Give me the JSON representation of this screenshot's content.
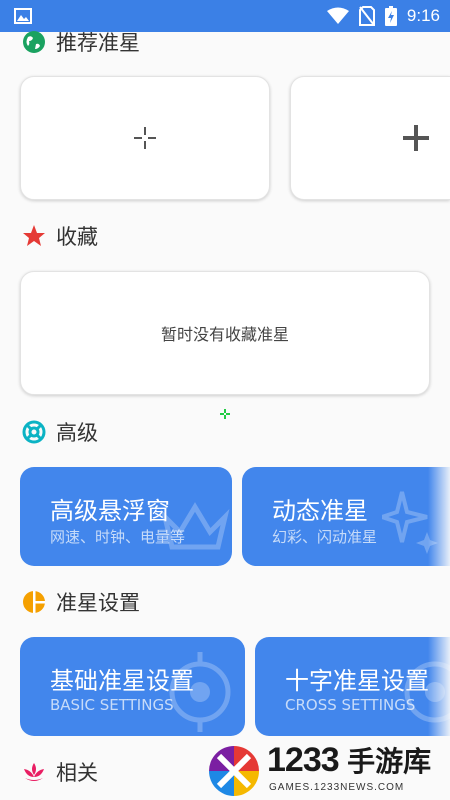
{
  "statusbar": {
    "time": "9:16"
  },
  "sections": {
    "recommended": {
      "title": "推荐准星"
    },
    "favorites": {
      "title": "收藏",
      "empty_text": "暂时没有收藏准星"
    },
    "advanced": {
      "title": "高级"
    },
    "crosshair_settings": {
      "title": "准星设置"
    },
    "related": {
      "title": "相关"
    }
  },
  "advanced_cards": [
    {
      "title": "高级悬浮窗",
      "subtitle": "网速、时钟、电量等"
    },
    {
      "title": "动态准星",
      "subtitle": "幻彩、闪动准星"
    }
  ],
  "settings_cards": [
    {
      "title": "基础准星设置",
      "subtitle": "BASIC SETTINGS"
    },
    {
      "title": "十字准星设置",
      "subtitle": "CROSS SETTINGS"
    }
  ],
  "watermark": {
    "number": "1233",
    "name": "手游库",
    "site": "GAMES.1233NEWS.COM"
  },
  "colors": {
    "statusbar": "#3b80e6",
    "card_blue": "#4286ec",
    "green": "#1aa260",
    "red": "#e53935",
    "teal": "#0bb3c4",
    "orange": "#f5a000",
    "pink": "#e91e63"
  }
}
